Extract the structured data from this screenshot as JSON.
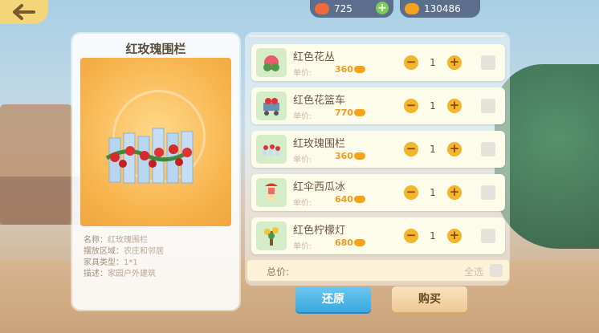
{
  "topbar": {
    "back_icon": "back-arrow-icon",
    "currency_1": {
      "icon": "peach-icon",
      "value": "725",
      "plus": "+"
    },
    "currency_2": {
      "icon": "coin-icon",
      "value": "130486"
    }
  },
  "detail": {
    "title": "红玫瑰围栏",
    "preview_icon": "rose-fence-icon",
    "info": [
      {
        "key": "名称：",
        "value": "红玫瑰围栏"
      },
      {
        "key": "摆放区域：",
        "value": "农庄和邻居"
      },
      {
        "key": "家具类型：",
        "value": "1*1"
      },
      {
        "key": "描述：",
        "value": "家园户外建筑"
      }
    ]
  },
  "list": {
    "price_label": "单价:",
    "items": [
      {
        "name": "红色花丛",
        "price": "360",
        "qty": "1",
        "icon": "flower-bush-icon"
      },
      {
        "name": "红色花篮车",
        "price": "770",
        "qty": "1",
        "icon": "flower-cart-icon"
      },
      {
        "name": "红玫瑰围栏",
        "price": "360",
        "qty": "1",
        "icon": "rose-fence-icon"
      },
      {
        "name": "红伞西瓜冰",
        "price": "640",
        "qty": "1",
        "icon": "watermelon-ice-icon"
      },
      {
        "name": "红色柠檬灯",
        "price": "680",
        "qty": "1",
        "icon": "lemon-lamp-icon"
      }
    ],
    "minus": "−",
    "plus": "+"
  },
  "footer": {
    "total_label": "总价:",
    "select_all": "全选",
    "restore": "还原",
    "buy": "购买"
  },
  "colors": {
    "accent": "#f2b52b",
    "price": "#f29b1c",
    "restore_btn": "#3aa7df",
    "buy_btn": "#eec893"
  }
}
